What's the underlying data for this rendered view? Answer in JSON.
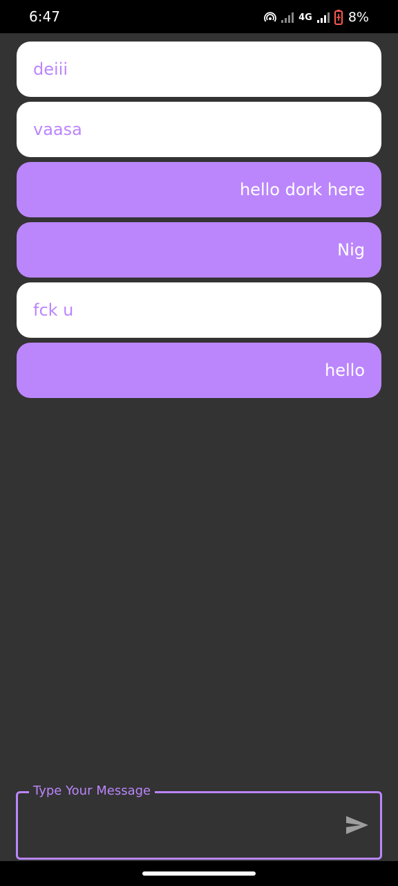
{
  "status_bar": {
    "time": "6:47",
    "network_type": "4G",
    "battery_percent": "8%",
    "icons": [
      "hotspot-icon",
      "signal-icon",
      "signal-icon",
      "battery-icon"
    ]
  },
  "messages": [
    {
      "text": "deiii",
      "direction": "received"
    },
    {
      "text": "vaasa",
      "direction": "received"
    },
    {
      "text": "hello dork here",
      "direction": "sent"
    },
    {
      "text": "Nig",
      "direction": "sent"
    },
    {
      "text": "fck u",
      "direction": "received"
    },
    {
      "text": "hello",
      "direction": "sent"
    }
  ],
  "composer": {
    "label": "Type Your Message",
    "value": "",
    "send_icon": "send-icon"
  },
  "colors": {
    "background": "#333333",
    "accent": "#bb86fc",
    "received_bubble": "#ffffff",
    "bars": "#000000"
  }
}
